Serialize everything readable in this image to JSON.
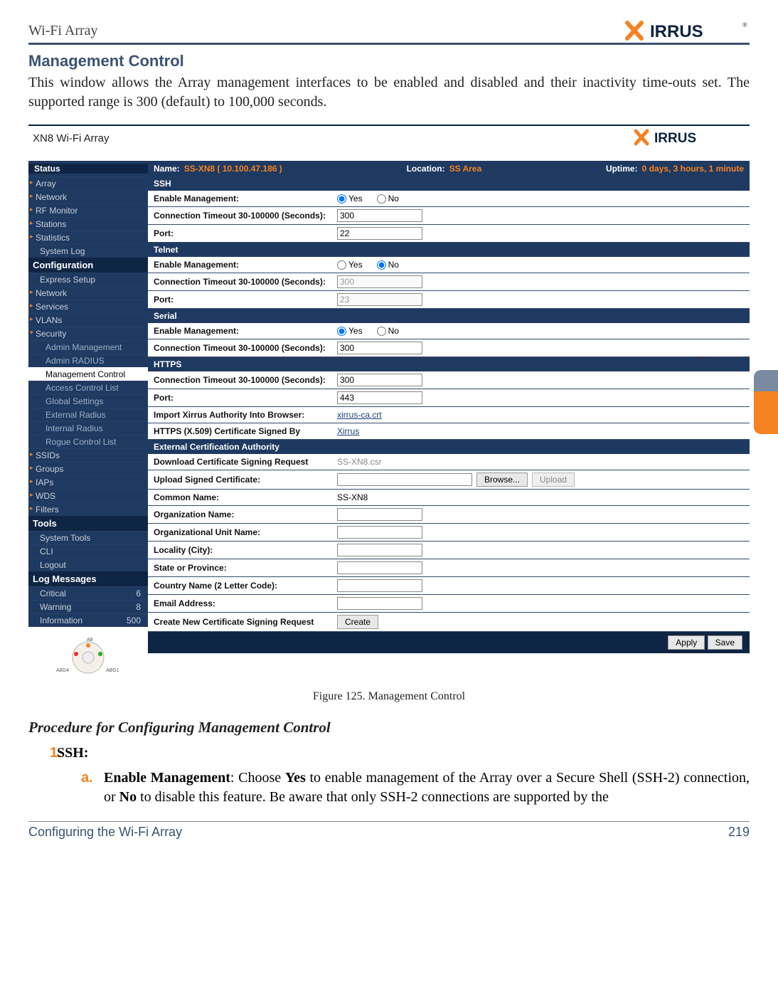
{
  "header": {
    "title": "Wi-Fi Array",
    "logo_text": "XIRRUS"
  },
  "section": {
    "heading": "Management Control"
  },
  "intro": "This window allows the Array management interfaces to be enabled and disabled and their inactivity time-outs set. The supported range is 300 (default) to 100,000 seconds.",
  "screenshot": {
    "device": "XN8 Wi-Fi Array",
    "logo": "XIRRUS",
    "status_bar": {
      "name_label": "Name:",
      "name_value": "SS-XN8   ( 10.100.47.186 )",
      "loc_label": "Location:",
      "loc_value": "SS Area",
      "up_label": "Uptime:",
      "up_value": "0 days, 3 hours, 1 minute"
    },
    "nav": {
      "s0": "Status",
      "s0a": "Array",
      "s0b": "Network",
      "s0c": "RF Monitor",
      "s0d": "Stations",
      "s0e": "Statistics",
      "s0f": "System Log",
      "s1": "Configuration",
      "s1a": "Express Setup",
      "s1b": "Network",
      "s1c": "Services",
      "s1d": "VLANs",
      "s1e": "Security",
      "s1e1": "Admin Management",
      "s1e2": "Admin RADIUS",
      "s1e3": "Management Control",
      "s1e4": "Access Control List",
      "s1e5": "Global Settings",
      "s1e6": "External Radius",
      "s1e7": "Internal Radius",
      "s1e8": "Rogue Control List",
      "s1f": "SSIDs",
      "s1g": "Groups",
      "s1h": "IAPs",
      "s1i": "WDS",
      "s1j": "Filters",
      "s2": "Tools",
      "s2a": "System Tools",
      "s2b": "CLI",
      "s2c": "Logout",
      "s3": "Log Messages",
      "s3a": "Critical",
      "s3ac": "6",
      "s3b": "Warning",
      "s3bc": "8",
      "s3c": "Information",
      "s3cc": "500"
    },
    "sections": {
      "ssh": "SSH",
      "telnet": "Telnet",
      "serial": "Serial",
      "https": "HTTPS",
      "ext": "External Certification Authority"
    },
    "labels": {
      "enable_mgmt": "Enable Management:",
      "conn_timeout": "Connection Timeout 30-100000 (Seconds):",
      "port": "Port:",
      "import_auth": "Import Xirrus Authority Into Browser:",
      "cert_signed": "HTTPS (X.509) Certificate Signed By",
      "download_csr": "Download Certificate Signing Request",
      "upload_cert": "Upload Signed Certificate:",
      "common_name": "Common Name:",
      "org_name": "Organization Name:",
      "ou_name": "Organizational Unit Name:",
      "locality": "Locality (City):",
      "state": "State or Province:",
      "country": "Country Name (2 Letter Code):",
      "email": "Email Address:",
      "create_csr": "Create New Certificate Signing Request"
    },
    "values": {
      "yes": "Yes",
      "no": "No",
      "ssh_timeout": "300",
      "ssh_port": "22",
      "telnet_timeout": "300",
      "telnet_port": "23",
      "serial_timeout": "300",
      "https_timeout": "300",
      "https_port": "443",
      "auth_file": "xirrus-ca.crt",
      "signed_by": "Xirrus",
      "csr_file": "SS-XN8.csr",
      "common_name": "SS-XN8",
      "browse": "Browse...",
      "upload": "Upload",
      "create": "Create",
      "apply": "Apply",
      "save": "Save"
    },
    "map": {
      "l1": "A8G4",
      "l2": "A8",
      "l3": "ABG1"
    }
  },
  "fig_caption": "Figure 125. Management Control",
  "procedure": {
    "heading": "Procedure for Configuring Management Control"
  },
  "step1": {
    "num": "1.",
    "label": "SSH:"
  },
  "step1a": {
    "num": "a.",
    "t1": "Enable Management",
    "t2": ": Choose ",
    "t3": "Yes",
    "t4": " to enable management of the Array over a Secure Shell (SSH-2) connection, or ",
    "t5": "No",
    "t6": " to disable this feature. Be aware that only SSH-2 connections are supported by the"
  },
  "footer": {
    "left": "Configuring the Wi-Fi Array",
    "right": "219"
  }
}
